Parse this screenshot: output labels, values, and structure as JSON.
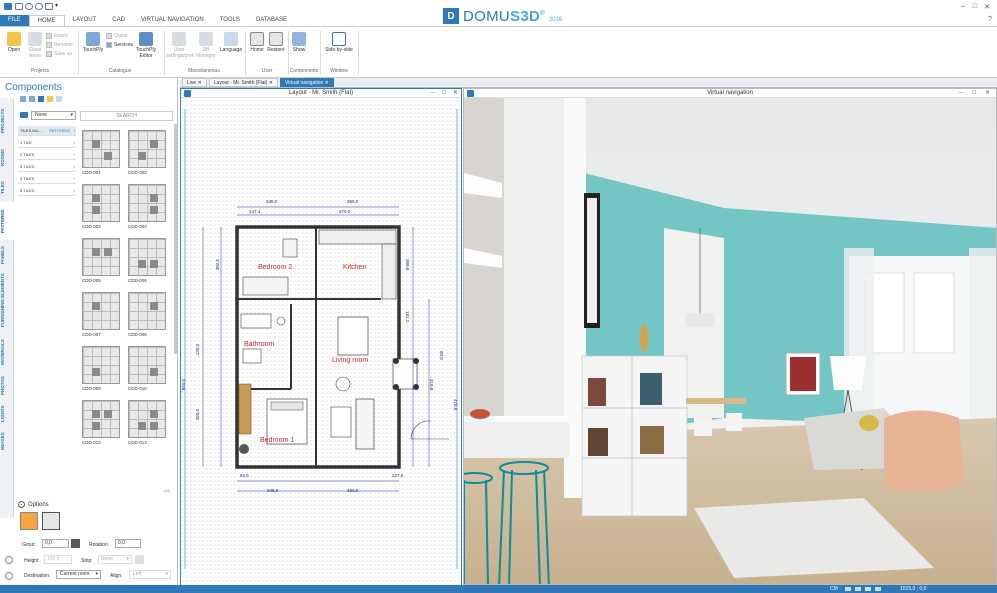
{
  "app": {
    "brand_name_a": "DOMU",
    "brand_name_b": "S3D",
    "brand_year": "2016",
    "brand_mark": "®"
  },
  "ribbon_tabs": [
    "FILE",
    "HOME",
    "LAYOUT",
    "CAD",
    "VIRTUAL NAVIGATION",
    "TOOLS",
    "DATABASE"
  ],
  "ribbon": {
    "open": "Open",
    "close_views": "Close views",
    "empty": "Empty",
    "rename": "Rename",
    "save_as": "Save as",
    "group_projects": "Projects",
    "touchply": "TouchPly",
    "quote": "Quote",
    "services": "Services",
    "touchply_editor": "TouchPly Editor",
    "group_catalogue": "Catalogue",
    "user_settings": "User settings/pref.",
    "db_manager": "DB Manager",
    "language": "Language",
    "group_miscellaneous": "Miscellaneous",
    "home": "Home",
    "restore": "Restore",
    "group_user": "User",
    "show": "Show",
    "group_components": "Components",
    "side_by_side": "Side-by-side",
    "group_window": "Window"
  },
  "left_panel": {
    "title": "Components",
    "filter_value": "None",
    "search_label": "SEARCH",
    "vertical_tabs": [
      "PROJECTS",
      "ROOMS",
      "TILES",
      "PATTERNS",
      "PANELS",
      "FURNISHING ELEMENTS",
      "MATERIALS",
      "PHOTOS",
      "LIGHTS",
      "IMAGES"
    ],
    "categories": [
      "TILES MU...",
      "1 TILE",
      "2 TILES",
      "3 TILES",
      "4 TILES",
      "5 TILES"
    ],
    "category_badge": "PATTERNS",
    "tiles": [
      "CDD-001",
      "CDD-002",
      "CDD-003",
      "CDD-004",
      "CDD-005",
      "CDD-006",
      "CDD-007",
      "CDD-008",
      "CDD-009",
      "CDD-010",
      "CDD-012",
      "CDD-013"
    ],
    "options_label": "Options",
    "grout_label": "Grout:",
    "grout_value": "0,0",
    "rotation_label": "Rotation:",
    "rotation_value": "0,0",
    "height_label": "Height",
    "height_value": "100,0",
    "strip_label": "Strip:",
    "strip_value": "None",
    "destination_label": "Destination:",
    "destination_value": "Current room",
    "align_label": "Align:",
    "align_value": "Left",
    "count": "126"
  },
  "doc_tabs": [
    "Live",
    "Layout - Mr. Smith (Flat)",
    "Virtual navigation"
  ],
  "layout_panel": {
    "title": "Layout - Mr. Smith (Flat)",
    "rooms": {
      "bedroom2": "Bedroom 2",
      "kitchen": "Kitchen",
      "bathroom": "Bathroom",
      "living": "Living room",
      "bedroom1": "Bedroom 1"
    },
    "dims": {
      "top_a": "345,0",
      "top_b": "365,0",
      "top_c": "147,4",
      "top_d": "270,0",
      "left_a": "382,5",
      "left_b": "120,0",
      "left_c": "850,0",
      "left_d": "360,0",
      "right_a": "380,0",
      "right_b": "181,2",
      "right_c": "80,0",
      "right_d": "310,0",
      "right_e": "470,0",
      "bot_a": "82,5",
      "bot_b": "227,5",
      "bot_c": "345,0",
      "bot_d": "490,0"
    }
  },
  "virtual_panel": {
    "title": "Virtual navigation"
  },
  "status": {
    "unit": "CM",
    "coords": "1015,0 ; 0,0"
  },
  "colors": {
    "accent": "#2f79b8",
    "teal_wall": "#74c6c4",
    "room_label": "#c62828"
  }
}
